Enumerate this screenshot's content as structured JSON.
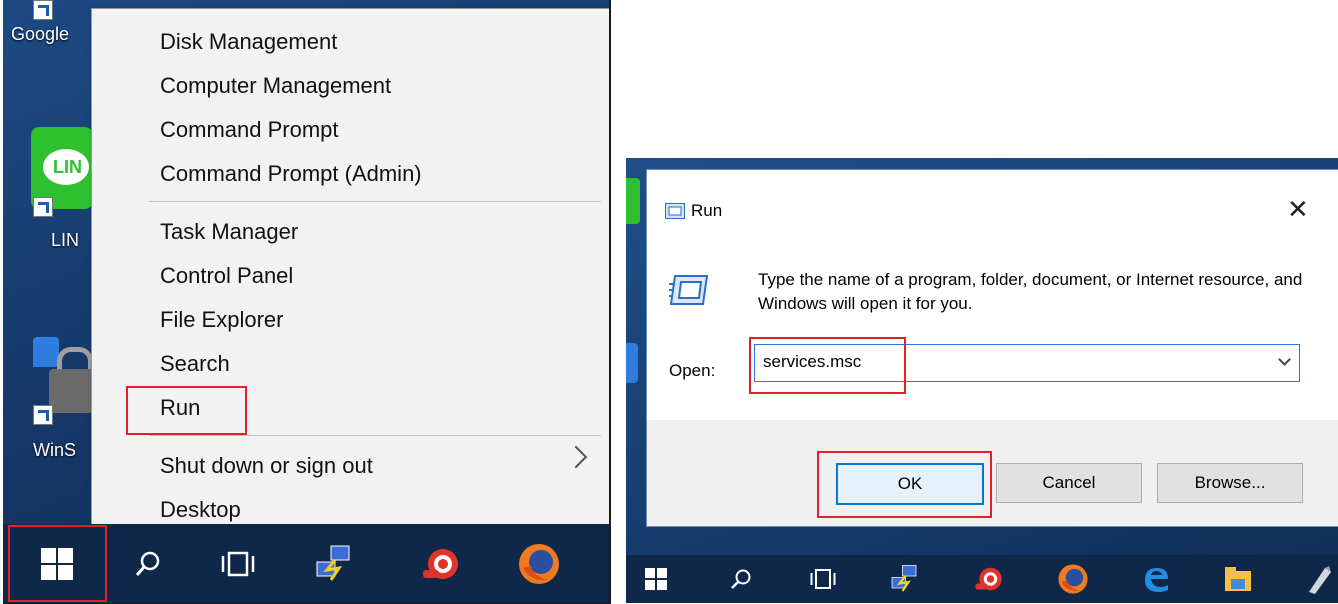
{
  "desktop_left": {
    "icons": [
      {
        "label": "Google"
      },
      {
        "label": "LIN"
      },
      {
        "label": "WinS"
      }
    ],
    "line_logo_text": "LIN"
  },
  "winx_menu": {
    "items": [
      {
        "label": "Disk Management"
      },
      {
        "label": "Computer Management"
      },
      {
        "label": "Command Prompt"
      },
      {
        "label": "Command Prompt (Admin)"
      },
      {
        "label": "Task Manager"
      },
      {
        "label": "Control Panel"
      },
      {
        "label": "File Explorer"
      },
      {
        "label": "Search"
      },
      {
        "label": "Run"
      },
      {
        "label": "Shut down or sign out"
      },
      {
        "label": "Desktop"
      }
    ]
  },
  "taskbar_left_icons": [
    "windows-start-icon",
    "search-icon",
    "task-view-icon",
    "network-app-icon",
    "shell-app-icon",
    "firefox-icon"
  ],
  "run_dialog": {
    "title": "Run",
    "close_glyph": "✕",
    "description": "Type the name of a program, folder, document, or Internet resource, and Windows will open it for you.",
    "open_label": "Open:",
    "open_value": "services.msc",
    "buttons": {
      "ok": "OK",
      "cancel": "Cancel",
      "browse": "Browse..."
    }
  },
  "taskbar_right_icons": [
    "windows-start-icon",
    "search-icon",
    "task-view-icon",
    "network-app-icon",
    "shell-app-icon",
    "firefox-icon",
    "edge-icon",
    "file-explorer-icon",
    "app-icon"
  ],
  "colors": {
    "highlight": "#e3202a",
    "accent": "#0078d7",
    "taskbar": "#0f2748"
  }
}
